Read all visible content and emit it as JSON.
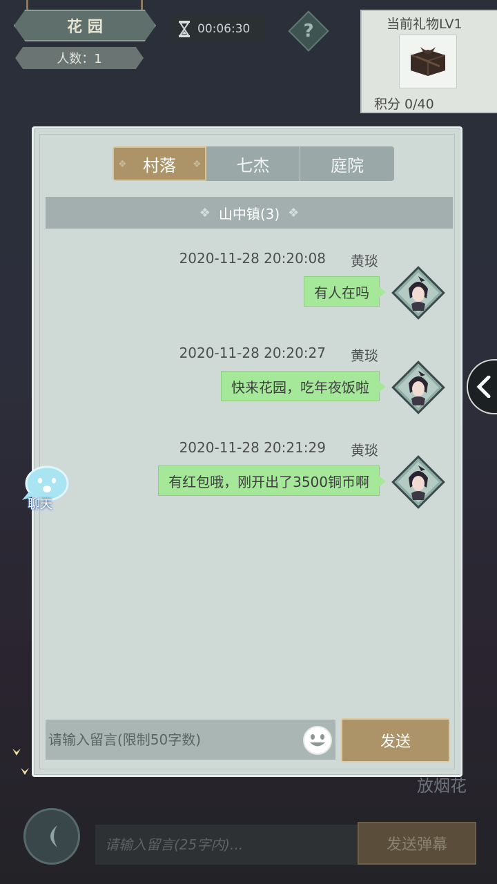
{
  "hud": {
    "garden_sign": "花 园",
    "people_count": "人数：1",
    "timer": "00:06:30",
    "help": "?",
    "gift_title": "当前礼物LV1",
    "gift_score": "积分 0/40"
  },
  "dialog": {
    "tabs": [
      {
        "label": "村落",
        "active": true
      },
      {
        "label": "七杰",
        "active": false
      },
      {
        "label": "庭院",
        "active": false
      }
    ],
    "channel": "山中镇(3)",
    "messages": [
      {
        "timestamp": "2020-11-28  20:20:08",
        "sender": "黄琰",
        "text": "有人在吗"
      },
      {
        "timestamp": "2020-11-28  20:20:27",
        "sender": "黄琰",
        "text": "快来花园，吃年夜饭啦"
      },
      {
        "timestamp": "2020-11-28  20:21:29",
        "sender": "黄琰",
        "text": "有红包哦，刚开出了3500铜币啊"
      }
    ],
    "input_placeholder": "请输入留言(限制50字数)",
    "send_label": "发送"
  },
  "side": {
    "chat_label": "聊天",
    "fireworks_label": "放烟花"
  },
  "bottom": {
    "danmaku_placeholder": "请输入留言(25字内)...",
    "danmaku_send": "发送弹幕"
  },
  "colors": {
    "accent_gold": "#ad9468",
    "bubble_green": "#a5e89a",
    "dialog_bg": "#cfdad7"
  }
}
